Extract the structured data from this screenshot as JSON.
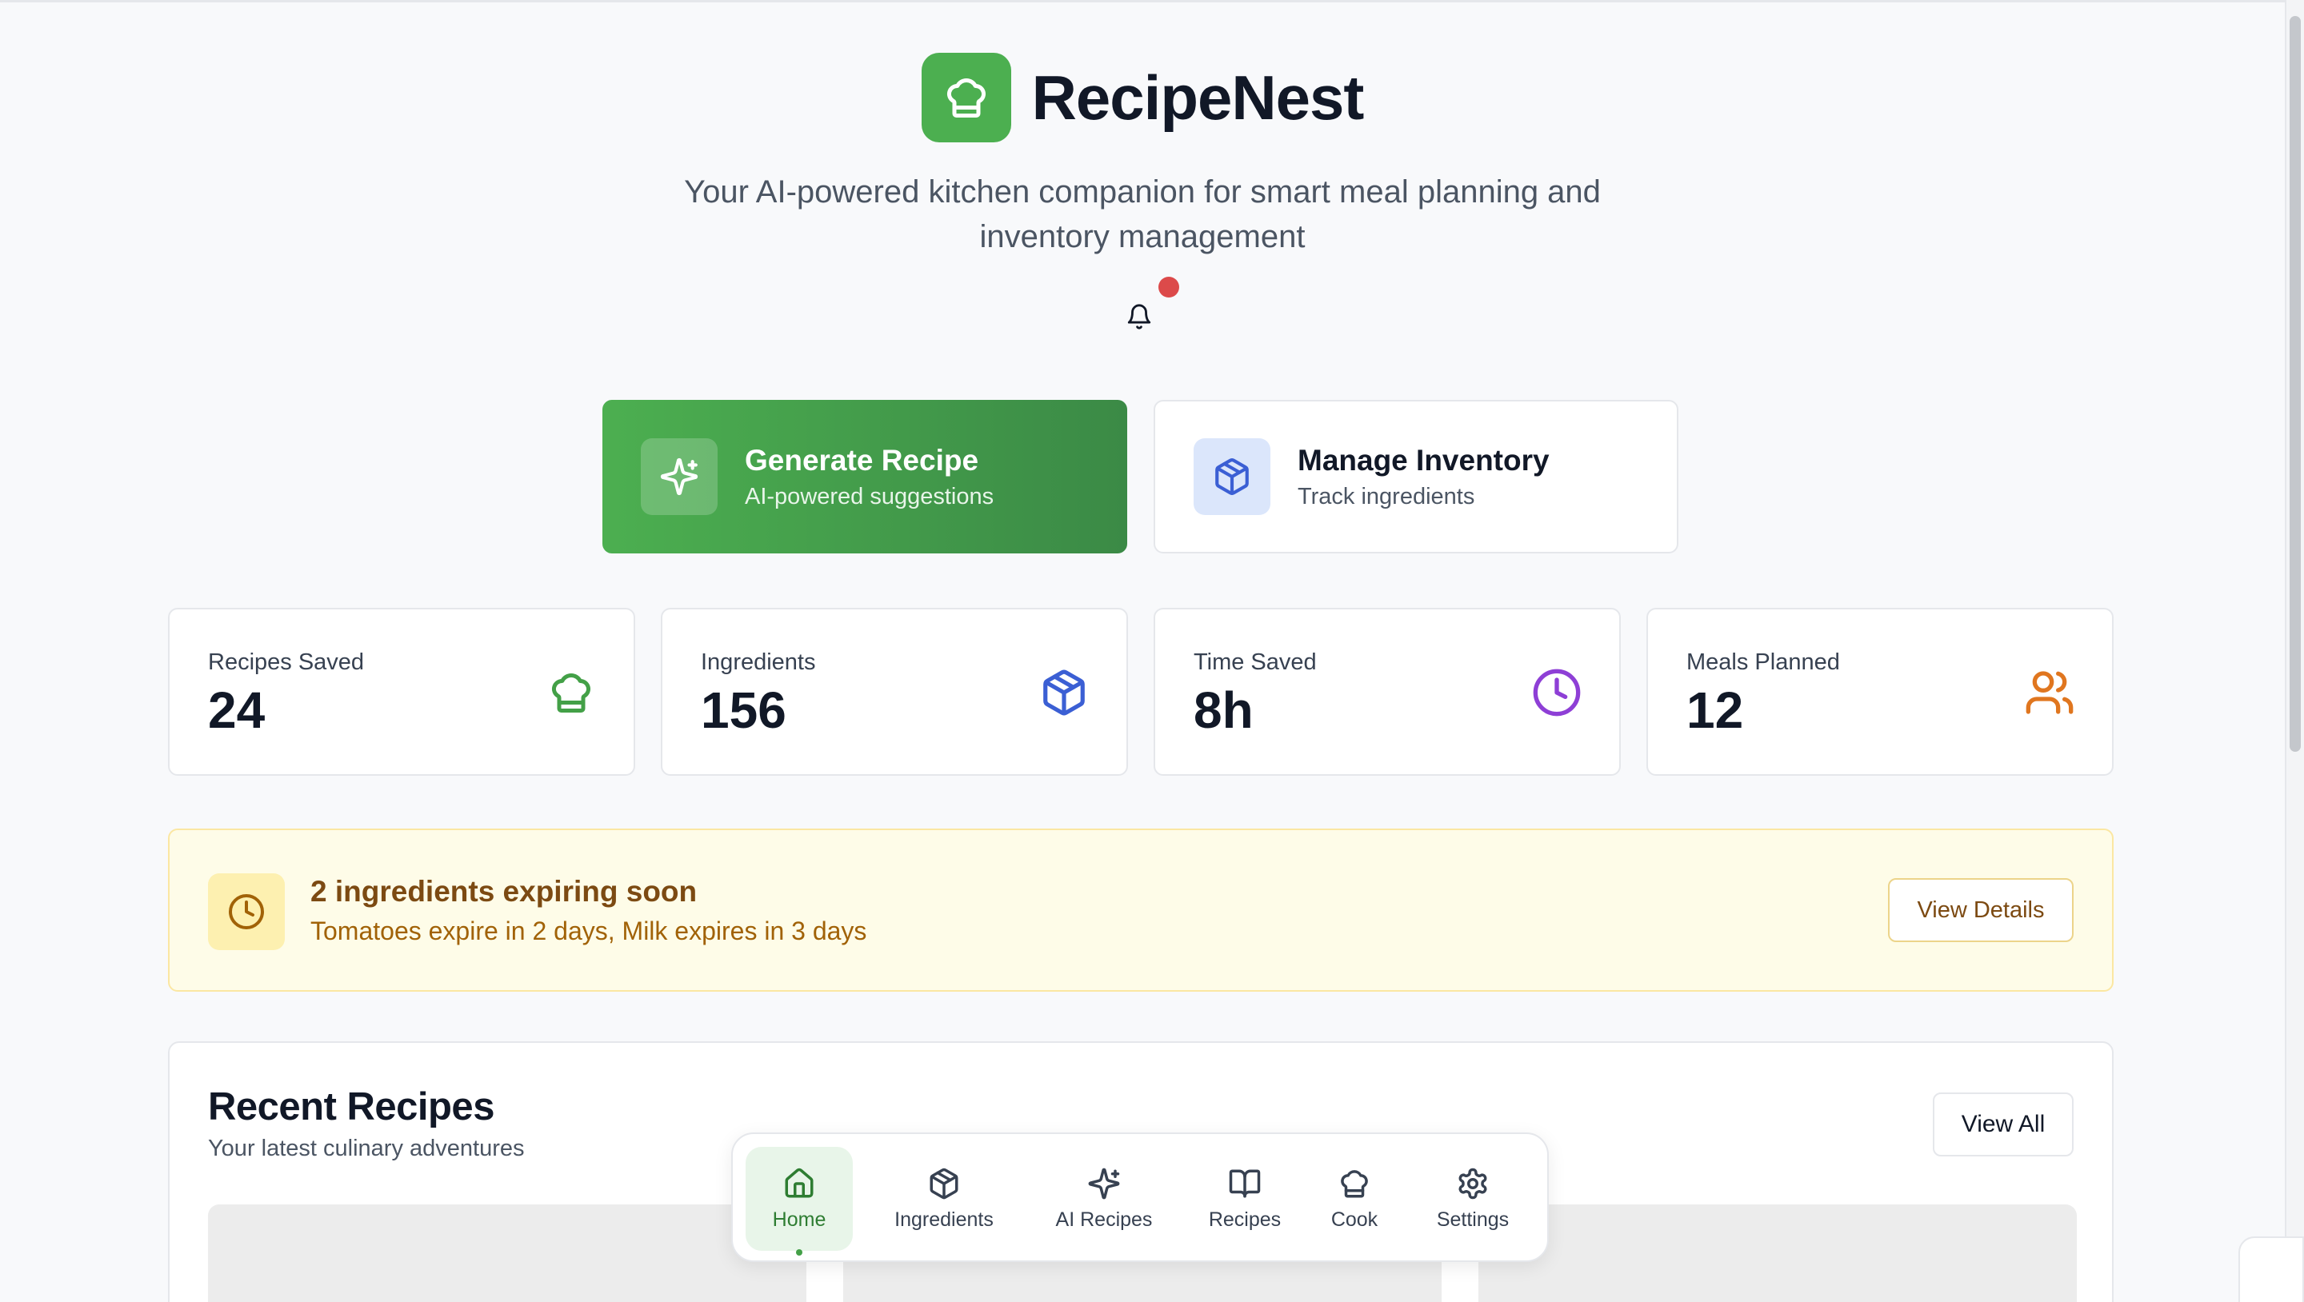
{
  "app": {
    "name": "RecipeNest",
    "tagline": "Your AI-powered kitchen companion for smart meal planning and inventory management"
  },
  "actions": [
    {
      "title": "Generate Recipe",
      "subtitle": "AI-powered suggestions",
      "icon": "sparkles-icon"
    },
    {
      "title": "Manage Inventory",
      "subtitle": "Track ingredients",
      "icon": "box-icon"
    }
  ],
  "stats": [
    {
      "label": "Recipes Saved",
      "value": "24",
      "icon": "chef-hat-icon",
      "color": "#43a047"
    },
    {
      "label": "Ingredients",
      "value": "156",
      "icon": "box-icon",
      "color": "#3b5fd4"
    },
    {
      "label": "Time Saved",
      "value": "8h",
      "icon": "clock-icon",
      "color": "#8e3fd6"
    },
    {
      "label": "Meals Planned",
      "value": "12",
      "icon": "users-icon",
      "color": "#e0761f"
    }
  ],
  "alert": {
    "title": "2 ingredients expiring soon",
    "message": "Tomatoes expire in 2 days, Milk expires in 3 days",
    "button": "View Details"
  },
  "recent": {
    "title": "Recent Recipes",
    "subtitle": "Your latest culinary adventures",
    "view_all": "View All"
  },
  "nav": {
    "items": [
      {
        "label": "Home",
        "icon": "home-icon",
        "active": true
      },
      {
        "label": "Ingredients",
        "icon": "box-icon"
      },
      {
        "label": "AI Recipes",
        "icon": "sparkles-icon"
      },
      {
        "label": "Recipes",
        "icon": "book-icon"
      },
      {
        "label": "Cook",
        "icon": "chef-hat-icon"
      },
      {
        "label": "Settings",
        "icon": "gear-icon"
      }
    ]
  },
  "colors": {
    "brand": "#4caf50",
    "alert_bg": "#fefce8",
    "notification": "#dc4a4a"
  }
}
